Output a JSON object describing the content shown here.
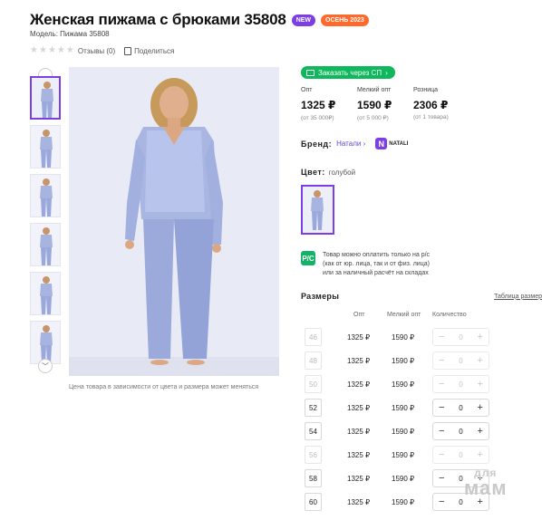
{
  "product": {
    "title": "Женская пижама с брюками 35808",
    "badges": [
      "NEW",
      "ОСЕНЬ 2023"
    ],
    "model": "Модель: Пижама 35808",
    "reviews": "Отзывы (0)",
    "share": "Поделиться",
    "stars": 0
  },
  "gallery": {
    "photo_note": "Цена товара в зависимости от цвета и размера может меняться",
    "thumb_count": 6
  },
  "actions": {
    "order_sp": "Заказать через СП"
  },
  "prices": [
    {
      "label": "Опт",
      "value": "1325 ₽",
      "sub": "(от 35 000₽)"
    },
    {
      "label": "Мелкий опт",
      "value": "1590 ₽",
      "sub": "(от 5 000 ₽)"
    },
    {
      "label": "Розница",
      "value": "2306 ₽",
      "sub": "(от 1 товара)"
    }
  ],
  "brand": {
    "label": "Бренд:",
    "name": "Натали",
    "logo_text": "NATALI"
  },
  "color": {
    "label": "Цвет:",
    "value": "голубой"
  },
  "payment": {
    "icon": "Р/С",
    "lines": [
      "Товар можно оплатить только на р/с",
      "(как от юр. лица, так и от физ. лица)",
      "или за наличный расчёт на складах"
    ]
  },
  "sizes": {
    "title": "Размеры",
    "table_link": "Таблица размер",
    "headers": {
      "opt": "Опт",
      "melkiy": "Мелкий опт",
      "qty": "Количество"
    },
    "rows": [
      {
        "size": "46",
        "opt": "1325 ₽",
        "melkiy": "1590 ₽",
        "qty": "0",
        "available": false
      },
      {
        "size": "48",
        "opt": "1325 ₽",
        "melkiy": "1590 ₽",
        "qty": "0",
        "available": false
      },
      {
        "size": "50",
        "opt": "1325 ₽",
        "melkiy": "1590 ₽",
        "qty": "0",
        "available": false
      },
      {
        "size": "52",
        "opt": "1325 ₽",
        "melkiy": "1590 ₽",
        "qty": "0",
        "available": true
      },
      {
        "size": "54",
        "opt": "1325 ₽",
        "melkiy": "1590 ₽",
        "qty": "0",
        "available": true
      },
      {
        "size": "56",
        "opt": "1325 ₽",
        "melkiy": "1590 ₽",
        "qty": "0",
        "available": false
      },
      {
        "size": "58",
        "opt": "1325 ₽",
        "melkiy": "1590 ₽",
        "qty": "0",
        "available": true
      },
      {
        "size": "60",
        "opt": "1325 ₽",
        "melkiy": "1590 ₽",
        "qty": "0",
        "available": true
      }
    ]
  },
  "watermark": {
    "line1": "для",
    "line2": "мам"
  },
  "colors": {
    "accent": "#7b3fe4",
    "green": "#10b85d",
    "season": "#ff6a2c",
    "link": "#5b4bd3"
  }
}
